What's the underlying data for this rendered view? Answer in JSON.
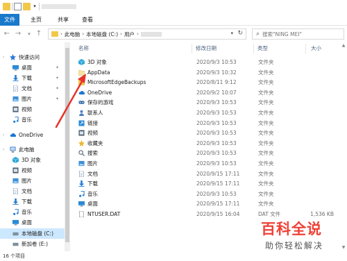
{
  "ribbon": {
    "file": "文件",
    "home": "主页",
    "share": "共享",
    "view": "查看"
  },
  "address": {
    "crumbs": [
      "此电脑",
      "本地磁盘 (C:)",
      "用户"
    ],
    "search_placeholder": "搜索\"NING MEI\""
  },
  "nav": {
    "items": [
      {
        "label": "快速访问",
        "icon": "star-icon",
        "color": "#2f7bd6",
        "pinned": false,
        "indent": 0
      },
      {
        "label": "桌面",
        "icon": "desktop-icon",
        "color": "#2a8ad6",
        "pinned": true,
        "indent": 1
      },
      {
        "label": "下载",
        "icon": "download-icon",
        "color": "#2a7fd4",
        "pinned": true,
        "indent": 1
      },
      {
        "label": "文档",
        "icon": "document-icon",
        "color": "#8aa0b8",
        "pinned": true,
        "indent": 1
      },
      {
        "label": "图片",
        "icon": "picture-icon",
        "color": "#3d8fd6",
        "pinned": true,
        "indent": 1
      },
      {
        "label": "视频",
        "icon": "video-icon",
        "color": "#4d5d6d",
        "pinned": false,
        "indent": 1
      },
      {
        "label": "音乐",
        "icon": "music-icon",
        "color": "#2a7fd4",
        "pinned": false,
        "indent": 1
      },
      {
        "label": "OneDrive",
        "icon": "cloud-icon",
        "color": "#1d76d2",
        "pinned": false,
        "indent": 0
      },
      {
        "label": "此电脑",
        "icon": "computer-icon",
        "color": "#4a7fbf",
        "pinned": false,
        "indent": 0
      },
      {
        "label": "3D 对象",
        "icon": "cube-icon",
        "color": "#2aa7d8",
        "pinned": false,
        "indent": 1
      },
      {
        "label": "视频",
        "icon": "video-icon",
        "color": "#4d5d6d",
        "pinned": false,
        "indent": 1
      },
      {
        "label": "图片",
        "icon": "picture-icon",
        "color": "#3d8fd6",
        "pinned": false,
        "indent": 1
      },
      {
        "label": "文档",
        "icon": "document-icon",
        "color": "#8aa0b8",
        "pinned": false,
        "indent": 1
      },
      {
        "label": "下载",
        "icon": "download-icon",
        "color": "#2a7fd4",
        "pinned": false,
        "indent": 1
      },
      {
        "label": "音乐",
        "icon": "music-icon",
        "color": "#2a7fd4",
        "pinned": false,
        "indent": 1
      },
      {
        "label": "桌面",
        "icon": "desktop-icon",
        "color": "#2a8ad6",
        "pinned": false,
        "indent": 1
      },
      {
        "label": "本地磁盘 (C:)",
        "icon": "drive-icon",
        "color": "#7f8f9f",
        "pinned": false,
        "indent": 1,
        "selected": true
      },
      {
        "label": "新加卷 (E:)",
        "icon": "drive-icon",
        "color": "#7f8f9f",
        "pinned": false,
        "indent": 1
      }
    ]
  },
  "columns": {
    "name": "名称",
    "date": "修改日期",
    "type": "类型",
    "size": "大小"
  },
  "files": [
    {
      "name": "3D 对象",
      "date": "2020/9/3 10:53",
      "type": "文件夹",
      "size": "",
      "icon": "cube-icon",
      "color": "#2aa7d8"
    },
    {
      "name": "AppData",
      "date": "2020/9/3 10:32",
      "type": "文件夹",
      "size": "",
      "icon": "folder-icon",
      "color": "#f5e3a8"
    },
    {
      "name": "MicrosoftEdgeBackups",
      "date": "2020/8/11 9:12",
      "type": "文件夹",
      "size": "",
      "icon": "folder-icon",
      "color": "#f2c84b"
    },
    {
      "name": "OneDrive",
      "date": "2020/9/2 10:07",
      "type": "文件夹",
      "size": "",
      "icon": "cloud-icon",
      "color": "#1d76d2"
    },
    {
      "name": "保存的游戏",
      "date": "2020/9/3 10:53",
      "type": "文件夹",
      "size": "",
      "icon": "game-icon",
      "color": "#3a6fa8"
    },
    {
      "name": "联系人",
      "date": "2020/9/3 10:53",
      "type": "文件夹",
      "size": "",
      "icon": "contacts-icon",
      "color": "#4a7fbf"
    },
    {
      "name": "链接",
      "date": "2020/9/3 10:53",
      "type": "文件夹",
      "size": "",
      "icon": "link-icon",
      "color": "#2a8ad6"
    },
    {
      "name": "视频",
      "date": "2020/9/3 10:53",
      "type": "文件夹",
      "size": "",
      "icon": "video-icon",
      "color": "#4d5d6d"
    },
    {
      "name": "收藏夹",
      "date": "2020/9/3 10:53",
      "type": "文件夹",
      "size": "",
      "icon": "star-icon",
      "color": "#e8b830"
    },
    {
      "name": "搜索",
      "date": "2020/9/3 10:53",
      "type": "文件夹",
      "size": "",
      "icon": "search-icon",
      "color": "#5a6a7a"
    },
    {
      "name": "图片",
      "date": "2020/9/3 10:53",
      "type": "文件夹",
      "size": "",
      "icon": "picture-icon",
      "color": "#3d8fd6"
    },
    {
      "name": "文档",
      "date": "2020/9/15 17:11",
      "type": "文件夹",
      "size": "",
      "icon": "document-icon",
      "color": "#8aa0b8"
    },
    {
      "name": "下载",
      "date": "2020/9/15 17:11",
      "type": "文件夹",
      "size": "",
      "icon": "download-icon",
      "color": "#2a7fd4"
    },
    {
      "name": "音乐",
      "date": "2020/9/3 10:53",
      "type": "文件夹",
      "size": "",
      "icon": "music-icon",
      "color": "#2a7fd4"
    },
    {
      "name": "桌面",
      "date": "2020/9/15 17:11",
      "type": "文件夹",
      "size": "",
      "icon": "desktop-icon",
      "color": "#2a8ad6"
    },
    {
      "name": "NTUSER.DAT",
      "date": "2020/9/15 16:04",
      "type": "DAT 文件",
      "size": "1,536 KB",
      "icon": "file-icon",
      "color": "#ffffff"
    }
  ],
  "status": {
    "count": "16 个项目"
  },
  "watermark": {
    "big": "百科全说",
    "small": "助你轻松解决"
  },
  "colors": {
    "accent": "#1979ca",
    "selection": "#cce8ff",
    "arrow": "#e8322a"
  }
}
